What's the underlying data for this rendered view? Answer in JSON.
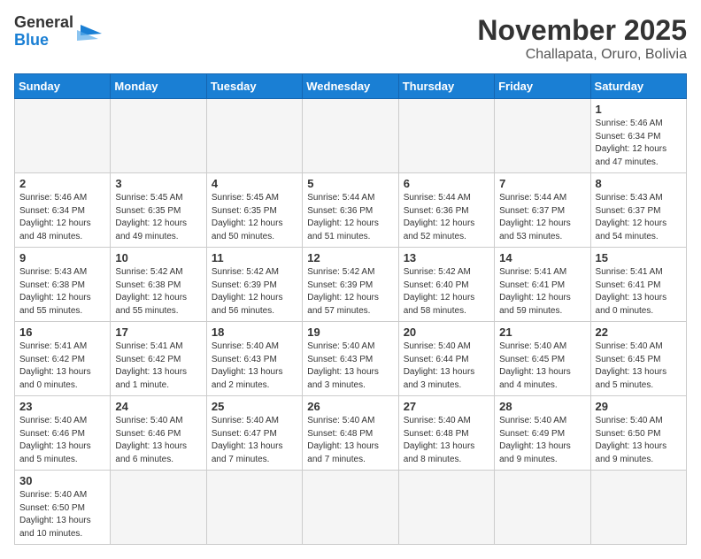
{
  "header": {
    "logo_general": "General",
    "logo_blue": "Blue",
    "month_title": "November 2025",
    "subtitle": "Challapata, Oruro, Bolivia"
  },
  "weekdays": [
    "Sunday",
    "Monday",
    "Tuesday",
    "Wednesday",
    "Thursday",
    "Friday",
    "Saturday"
  ],
  "weeks": [
    [
      {
        "day": "",
        "info": ""
      },
      {
        "day": "",
        "info": ""
      },
      {
        "day": "",
        "info": ""
      },
      {
        "day": "",
        "info": ""
      },
      {
        "day": "",
        "info": ""
      },
      {
        "day": "",
        "info": ""
      },
      {
        "day": "1",
        "info": "Sunrise: 5:46 AM\nSunset: 6:34 PM\nDaylight: 12 hours\nand 47 minutes."
      }
    ],
    [
      {
        "day": "2",
        "info": "Sunrise: 5:46 AM\nSunset: 6:34 PM\nDaylight: 12 hours\nand 48 minutes."
      },
      {
        "day": "3",
        "info": "Sunrise: 5:45 AM\nSunset: 6:35 PM\nDaylight: 12 hours\nand 49 minutes."
      },
      {
        "day": "4",
        "info": "Sunrise: 5:45 AM\nSunset: 6:35 PM\nDaylight: 12 hours\nand 50 minutes."
      },
      {
        "day": "5",
        "info": "Sunrise: 5:44 AM\nSunset: 6:36 PM\nDaylight: 12 hours\nand 51 minutes."
      },
      {
        "day": "6",
        "info": "Sunrise: 5:44 AM\nSunset: 6:36 PM\nDaylight: 12 hours\nand 52 minutes."
      },
      {
        "day": "7",
        "info": "Sunrise: 5:44 AM\nSunset: 6:37 PM\nDaylight: 12 hours\nand 53 minutes."
      },
      {
        "day": "8",
        "info": "Sunrise: 5:43 AM\nSunset: 6:37 PM\nDaylight: 12 hours\nand 54 minutes."
      }
    ],
    [
      {
        "day": "9",
        "info": "Sunrise: 5:43 AM\nSunset: 6:38 PM\nDaylight: 12 hours\nand 55 minutes."
      },
      {
        "day": "10",
        "info": "Sunrise: 5:42 AM\nSunset: 6:38 PM\nDaylight: 12 hours\nand 55 minutes."
      },
      {
        "day": "11",
        "info": "Sunrise: 5:42 AM\nSunset: 6:39 PM\nDaylight: 12 hours\nand 56 minutes."
      },
      {
        "day": "12",
        "info": "Sunrise: 5:42 AM\nSunset: 6:39 PM\nDaylight: 12 hours\nand 57 minutes."
      },
      {
        "day": "13",
        "info": "Sunrise: 5:42 AM\nSunset: 6:40 PM\nDaylight: 12 hours\nand 58 minutes."
      },
      {
        "day": "14",
        "info": "Sunrise: 5:41 AM\nSunset: 6:41 PM\nDaylight: 12 hours\nand 59 minutes."
      },
      {
        "day": "15",
        "info": "Sunrise: 5:41 AM\nSunset: 6:41 PM\nDaylight: 13 hours\nand 0 minutes."
      }
    ],
    [
      {
        "day": "16",
        "info": "Sunrise: 5:41 AM\nSunset: 6:42 PM\nDaylight: 13 hours\nand 0 minutes."
      },
      {
        "day": "17",
        "info": "Sunrise: 5:41 AM\nSunset: 6:42 PM\nDaylight: 13 hours\nand 1 minute."
      },
      {
        "day": "18",
        "info": "Sunrise: 5:40 AM\nSunset: 6:43 PM\nDaylight: 13 hours\nand 2 minutes."
      },
      {
        "day": "19",
        "info": "Sunrise: 5:40 AM\nSunset: 6:43 PM\nDaylight: 13 hours\nand 3 minutes."
      },
      {
        "day": "20",
        "info": "Sunrise: 5:40 AM\nSunset: 6:44 PM\nDaylight: 13 hours\nand 3 minutes."
      },
      {
        "day": "21",
        "info": "Sunrise: 5:40 AM\nSunset: 6:45 PM\nDaylight: 13 hours\nand 4 minutes."
      },
      {
        "day": "22",
        "info": "Sunrise: 5:40 AM\nSunset: 6:45 PM\nDaylight: 13 hours\nand 5 minutes."
      }
    ],
    [
      {
        "day": "23",
        "info": "Sunrise: 5:40 AM\nSunset: 6:46 PM\nDaylight: 13 hours\nand 5 minutes."
      },
      {
        "day": "24",
        "info": "Sunrise: 5:40 AM\nSunset: 6:46 PM\nDaylight: 13 hours\nand 6 minutes."
      },
      {
        "day": "25",
        "info": "Sunrise: 5:40 AM\nSunset: 6:47 PM\nDaylight: 13 hours\nand 7 minutes."
      },
      {
        "day": "26",
        "info": "Sunrise: 5:40 AM\nSunset: 6:48 PM\nDaylight: 13 hours\nand 7 minutes."
      },
      {
        "day": "27",
        "info": "Sunrise: 5:40 AM\nSunset: 6:48 PM\nDaylight: 13 hours\nand 8 minutes."
      },
      {
        "day": "28",
        "info": "Sunrise: 5:40 AM\nSunset: 6:49 PM\nDaylight: 13 hours\nand 9 minutes."
      },
      {
        "day": "29",
        "info": "Sunrise: 5:40 AM\nSunset: 6:50 PM\nDaylight: 13 hours\nand 9 minutes."
      }
    ],
    [
      {
        "day": "30",
        "info": "Sunrise: 5:40 AM\nSunset: 6:50 PM\nDaylight: 13 hours\nand 10 minutes."
      },
      {
        "day": "",
        "info": ""
      },
      {
        "day": "",
        "info": ""
      },
      {
        "day": "",
        "info": ""
      },
      {
        "day": "",
        "info": ""
      },
      {
        "day": "",
        "info": ""
      },
      {
        "day": "",
        "info": ""
      }
    ]
  ]
}
